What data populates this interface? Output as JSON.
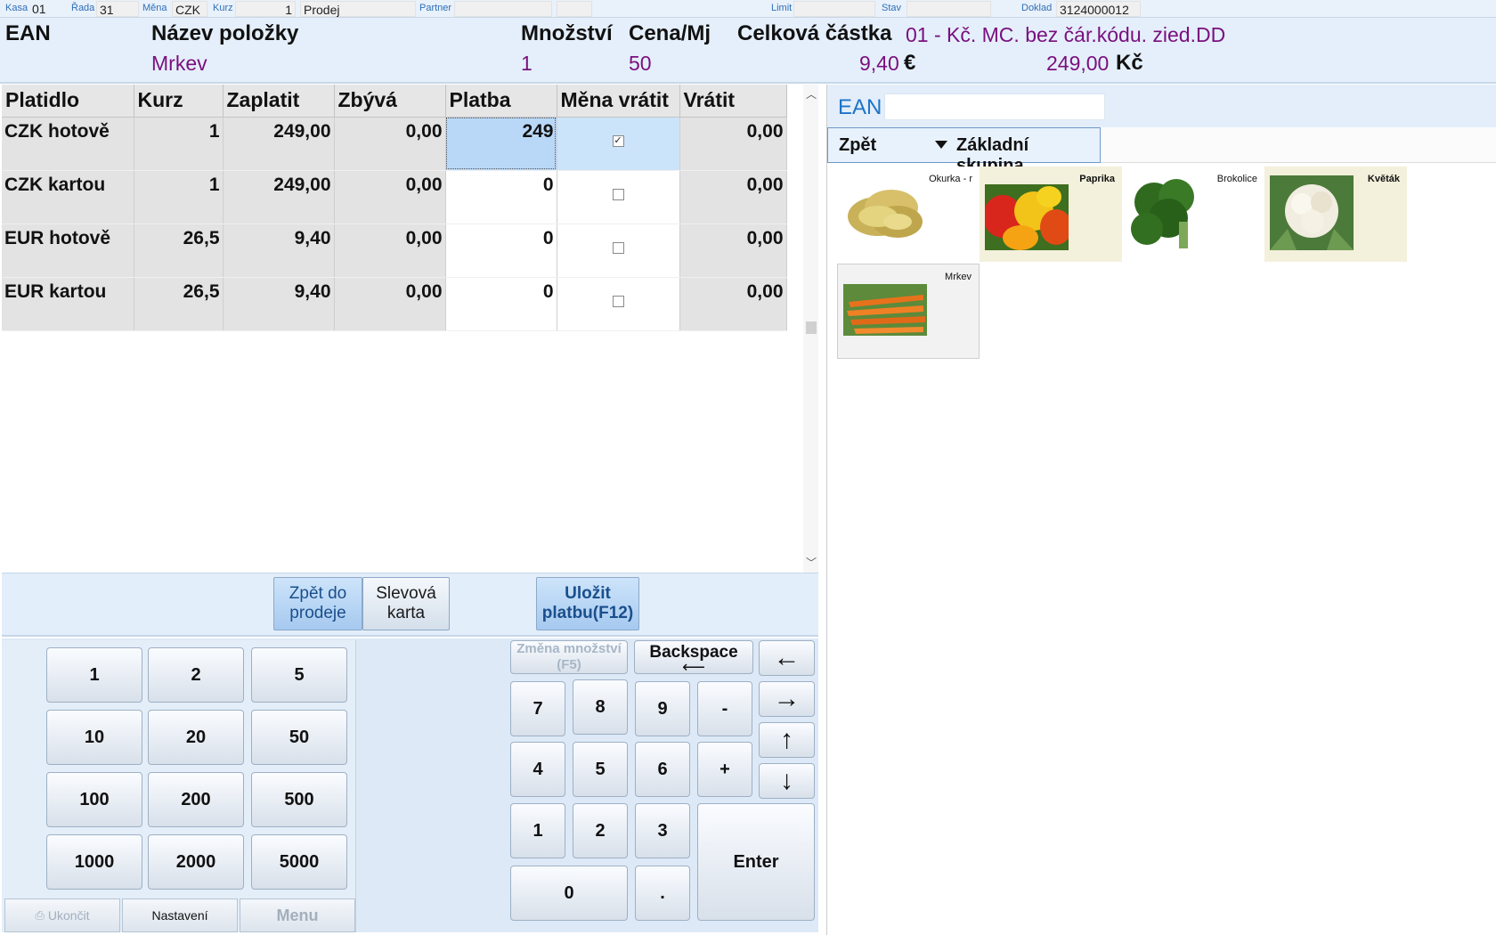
{
  "topbar": {
    "kasa_label": "Kasa",
    "kasa_value": "01",
    "rada_label": "Řada",
    "rada_value": "31",
    "mena_label": "Měna",
    "mena_value": "CZK",
    "kurz_label": "Kurz",
    "kurz_value": "1",
    "mode_value": "Prodej",
    "partner_label": "Partner",
    "limit_label": "Limit",
    "stav_label": "Stav",
    "doklad_label": "Doklad",
    "doklad_value": "3124000012"
  },
  "header": {
    "ean_label": "EAN",
    "name_label": "Název položky",
    "qty_label": "Množství",
    "price_label": "Cena/Mj",
    "total_label": "Celková částka",
    "item_name": "Mrkev",
    "qty": "1",
    "price": "50",
    "eur_total": "9,40",
    "eur_symbol": "€",
    "czk_total": "249,00",
    "czk_symbol": "Kč",
    "info": "01 - Kč. MC. bez čár.kódu. zied.DD"
  },
  "payment_table": {
    "columns": [
      "Platidlo",
      "Kurz",
      "Zaplatit",
      "Zbývá",
      "Platba",
      "Měna vrátit",
      "Vrátit"
    ],
    "rows": [
      {
        "platidlo": "CZK hotově",
        "kurz": "1",
        "zaplatit": "249,00",
        "zbyva": "0,00",
        "platba": "249",
        "mena_vratit": true,
        "vratit": "0,00"
      },
      {
        "platidlo": "CZK kartou",
        "kurz": "1",
        "zaplatit": "249,00",
        "zbyva": "0,00",
        "platba": "0",
        "mena_vratit": false,
        "vratit": "0,00"
      },
      {
        "platidlo": "EUR hotově",
        "kurz": "26,5",
        "zaplatit": "9,40",
        "zbyva": "0,00",
        "platba": "0",
        "mena_vratit": false,
        "vratit": "0,00"
      },
      {
        "platidlo": "EUR kartou",
        "kurz": "26,5",
        "zaplatit": "9,40",
        "zbyva": "0,00",
        "platba": "0",
        "mena_vratit": false,
        "vratit": "0,00"
      }
    ]
  },
  "actions": {
    "back_to_sale": "Zpět do prodeje",
    "discount_card": "Slevová karta",
    "save_payment": "Uložit platbu(F12)"
  },
  "amount_keys": [
    "1",
    "2",
    "5",
    "10",
    "20",
    "50",
    "100",
    "200",
    "500",
    "1000",
    "2000",
    "5000"
  ],
  "numpad": {
    "change_qty": "Změna množství (F5)",
    "backspace": "Backspace",
    "digits": [
      "7",
      "8",
      "9",
      "4",
      "5",
      "6",
      "1",
      "2",
      "3"
    ],
    "minus": "-",
    "plus": "+",
    "zero": "0",
    "dot": ".",
    "enter": "Enter"
  },
  "bottom": {
    "exit": "Ukončit",
    "settings": "Nastavení",
    "menu": "Menu"
  },
  "right_panel": {
    "ean_label": "EAN",
    "ean_value": "",
    "back": "Zpět",
    "group": "Základní skupina",
    "products": [
      {
        "name": "Okurka - r",
        "icon": "pickle-image"
      },
      {
        "name": "Paprika",
        "icon": "pepper-image"
      },
      {
        "name": "Brokolice",
        "icon": "broccoli-image"
      },
      {
        "name": "Květák",
        "icon": "cauliflower-image"
      },
      {
        "name": "Mrkev",
        "icon": "carrot-image"
      }
    ]
  },
  "colors": {
    "accent_purple": "#7a0f7e",
    "accent_blue": "#1e73c8",
    "header_bg": "#e4effb",
    "selected_cell": "#b9d8f7"
  }
}
